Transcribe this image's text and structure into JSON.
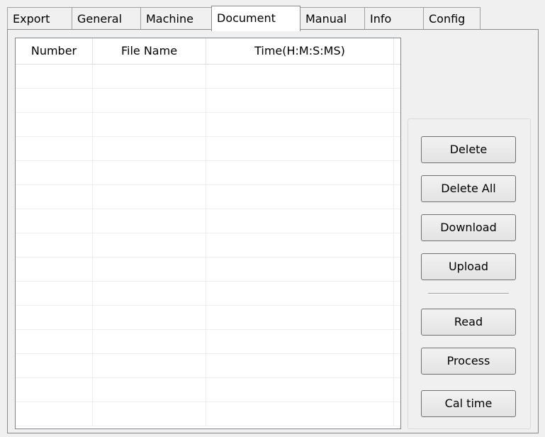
{
  "tabs": [
    {
      "label": "Export"
    },
    {
      "label": "General"
    },
    {
      "label": "Machine"
    },
    {
      "label": "Document"
    },
    {
      "label": "Manual"
    },
    {
      "label": "Info"
    },
    {
      "label": "Config"
    }
  ],
  "active_tab": "Document",
  "table": {
    "columns": [
      "Number",
      "File Name",
      "Time(H:M:S:MS)"
    ],
    "rows": []
  },
  "buttons": {
    "delete": "Delete",
    "delete_all": "Delete All",
    "download": "Download",
    "upload": "Upload",
    "read": "Read",
    "process": "Process",
    "cal_time": "Cal time"
  }
}
